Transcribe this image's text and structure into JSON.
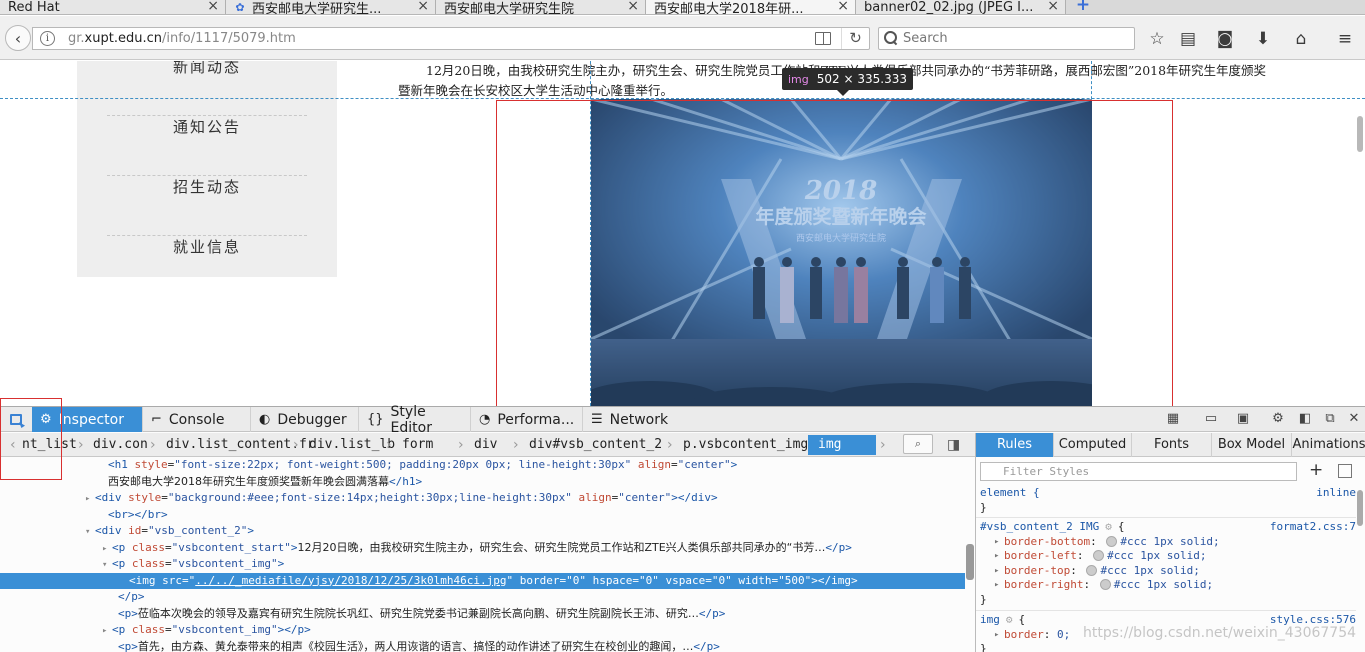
{
  "tabs": [
    {
      "label": "Red Hat",
      "favicon": "redhat-icon",
      "active": false
    },
    {
      "label": "西安邮电大学研究生...",
      "favicon": "paw-icon",
      "active": false
    },
    {
      "label": "西安邮电大学研究生院",
      "favicon": "",
      "active": false
    },
    {
      "label": "西安邮电大学2018年研...",
      "favicon": "",
      "active": true
    },
    {
      "label": "banner02_02.jpg (JPEG I...",
      "favicon": "",
      "active": false
    }
  ],
  "tab_close_glyph": "×",
  "new_tab_glyph": "+",
  "navbar": {
    "url_prefix": "gr.",
    "url_host": "xupt.edu.cn",
    "url_path": "/info/1117/5079.htm",
    "search_placeholder": "Search"
  },
  "sidebar": {
    "items": [
      {
        "label": "新闻动态"
      },
      {
        "label": "通知公告"
      },
      {
        "label": "招生动态"
      },
      {
        "label": "就业信息"
      }
    ]
  },
  "article": {
    "paragraph": "12月20日晚，由我校研究生院主办，研究生会、研究生院党员工作站和ZTE兴人类俱乐部共同承办的“书芳菲研路，展西邮宏图”2018年研究生年度颁奖暨新年晚会在长安校区大学生活动中心隆重举行。"
  },
  "image_tooltip": {
    "tag": "img",
    "dims": "502 × 335.333"
  },
  "stage_image": {
    "banner_title_year": "2018",
    "banner_title": "年度颁奖暨新年晚会",
    "banner_subtitle": "西安邮电大学研究生院"
  },
  "devtools": {
    "tabs": [
      {
        "label": "Inspector",
        "icon": "inspector-icon",
        "active": true
      },
      {
        "label": "Console",
        "icon": "console-icon",
        "active": false
      },
      {
        "label": "Debugger",
        "icon": "debugger-icon",
        "active": false
      },
      {
        "label": "Style Editor",
        "icon": "style-editor-icon",
        "active": false
      },
      {
        "label": "Performa...",
        "icon": "performance-icon",
        "active": false
      },
      {
        "label": "Network",
        "icon": "network-icon",
        "active": false
      }
    ],
    "breadcrumbs": [
      {
        "label": "nt_list",
        "active": false
      },
      {
        "label": "div.con",
        "active": false
      },
      {
        "label": "div.list_content.fr",
        "active": false
      },
      {
        "label": "div.list_lb",
        "active": false
      },
      {
        "label": "form",
        "active": false
      },
      {
        "label": "div",
        "active": false
      },
      {
        "label": "div#vsb_content_2",
        "active": false
      },
      {
        "label": "p.vsbcontent_img",
        "active": false
      },
      {
        "label": "img",
        "active": true
      }
    ],
    "markup_lines": [
      {
        "indent": 110,
        "twisty": "",
        "html": "<span class='tg'>&lt;h1</span> <span class='an'>style</span>=<span class='av'>\"font-size:22px; font-weight:500; padding:20px 0px; line-height:30px\"</span> <span class='an'>align</span>=<span class='av'>\"center\"</span><span class='tg'>&gt;</span>"
      },
      {
        "indent": 110,
        "twisty": "",
        "html": "<span class='tx'>西安邮电大学2018年研究生年度颁奖暨新年晚会圆满落幕</span><span class='tg'>&lt;/h1&gt;</span>"
      },
      {
        "indent": 97,
        "twisty": "▸",
        "html": "<span class='tg'>&lt;div</span> <span class='an'>style</span>=<span class='av'>\"background:#eee;font-size:14px;height:30px;line-height:30px\"</span> <span class='an'>align</span>=<span class='av'>\"center\"</span><span class='tg'>&gt;&lt;/div&gt;</span>"
      },
      {
        "indent": 110,
        "twisty": "",
        "html": "<span class='tg'>&lt;br&gt;&lt;/br&gt;</span>"
      },
      {
        "indent": 97,
        "twisty": "▾",
        "html": "<span class='tg'>&lt;div</span> <span class='an'>id</span>=<span class='av'>\"vsb_content_2\"</span><span class='tg'>&gt;</span>"
      },
      {
        "indent": 114,
        "twisty": "▸",
        "html": "<span class='tg'>&lt;p</span> <span class='an'>class</span>=<span class='av'>\"vsbcontent_start\"</span><span class='tg'>&gt;</span><span class='tx'>12月20日晚，由我校研究生院主办，研究生会、研究生院党员工作站和ZTE兴人类俱乐部共同承办的“书芳…</span><span class='tg'>&lt;/p&gt;</span>"
      },
      {
        "indent": 114,
        "twisty": "▾",
        "html": "<span class='tg'>&lt;p</span> <span class='an'>class</span>=<span class='av'>\"vsbcontent_img\"</span><span class='tg'>&gt;</span>"
      },
      {
        "indent": 131,
        "twisty": "",
        "selected": true,
        "html": "<span class='tg'>&lt;img</span> <span class='an'>src</span>=<span class='av'>\"<u>../../_mediafile/yjsy/2018/12/25/3k0lmh46ci.jpg</u>\"</span> <span class='an'>border</span>=<span class='av'>\"0\"</span> <span class='an'>hspace</span>=<span class='av'>\"0\"</span> <span class='an'>vspace</span>=<span class='av'>\"0\"</span> <span class='an'>width</span>=<span class='av'>\"500\"</span><span class='tg'>&gt;&lt;/img&gt;</span>"
      },
      {
        "indent": 120,
        "twisty": "",
        "html": "<span class='tg'>&lt;/p&gt;</span>"
      },
      {
        "indent": 120,
        "twisty": "",
        "html": "<span class='tg'>&lt;p&gt;</span><span class='tx'>莅临本次晚会的领导及嘉宾有研究生院院长巩红、研究生院党委书记兼副院长高向鹏、研究生院副院长王沛、研究…</span><span class='tg'>&lt;/p&gt;</span>"
      },
      {
        "indent": 114,
        "twisty": "▸",
        "html": "<span class='tg'>&lt;p</span> <span class='an'>class</span>=<span class='av'>\"vsbcontent_img\"</span><span class='tg'>&gt;&lt;/p&gt;</span>"
      },
      {
        "indent": 120,
        "twisty": "",
        "html": "<span class='tg'>&lt;p&gt;</span><span class='tx'>首先，由方森、黄允泰带来的相声《校园生活》，两人用诙谐的语言、搞怪的动作讲述了研究生在校创业的趣闻，…</span><span class='tg'>&lt;/p&gt;</span>"
      }
    ],
    "rules_tabs": [
      {
        "label": "Rules",
        "active": true
      },
      {
        "label": "Computed",
        "active": false
      },
      {
        "label": "Fonts",
        "active": false
      },
      {
        "label": "Box Model",
        "active": false
      },
      {
        "label": "Animations",
        "active": false
      }
    ],
    "filter_placeholder": "Filter Styles",
    "rules": {
      "element_selector": "element {",
      "element_src": "inline",
      "vsb_selector": "#vsb_content_2 IMG",
      "vsb_src": "format2.css:7",
      "vsb_props": [
        {
          "name": "border-bottom",
          "value": "#ccc 1px solid;"
        },
        {
          "name": "border-left",
          "value": "#ccc 1px solid;"
        },
        {
          "name": "border-top",
          "value": "#ccc 1px solid;"
        },
        {
          "name": "border-right",
          "value": "#ccc 1px solid;"
        }
      ],
      "img_selector": "img",
      "img_src": "style.css:576",
      "img_props": [
        {
          "name": "border",
          "value": "0;"
        }
      ],
      "open_brace": "{",
      "close_brace": "}"
    }
  },
  "watermark": "https://blog.csdn.net/weixin_43067754"
}
